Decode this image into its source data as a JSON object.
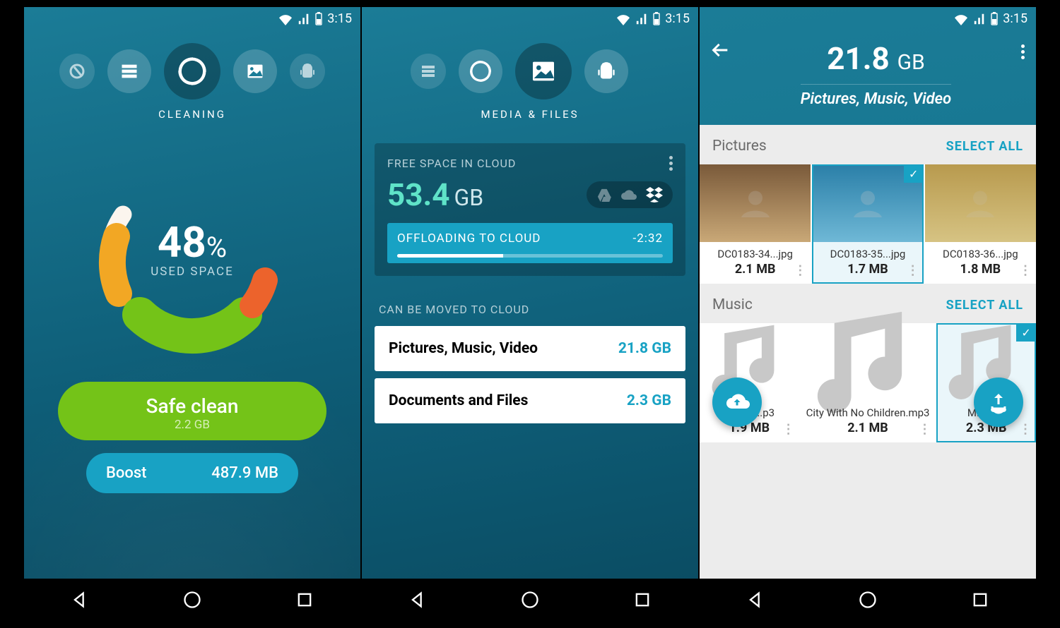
{
  "statusbar": {
    "time": "3:15"
  },
  "screen1": {
    "category_label": "CLEANING",
    "used_pct": "48",
    "pct_sym": "%",
    "used_label": "USED SPACE",
    "safe_clean": {
      "label": "Safe clean",
      "size": "2.2 GB"
    },
    "boost": {
      "label": "Boost",
      "size": "487.9 MB"
    }
  },
  "screen2": {
    "category_label": "MEDIA & FILES",
    "cloud_free_label": "FREE SPACE IN CLOUD",
    "cloud_free_value": "53.4",
    "cloud_free_unit": "GB",
    "offload_label": "OFFLOADING TO CLOUD",
    "offload_remaining": "-2:32",
    "move_label": "CAN BE MOVED TO CLOUD",
    "rows": [
      {
        "label": "Pictures, Music, Video",
        "value": "21.8 GB"
      },
      {
        "label": "Documents and Files",
        "value": "2.3 GB"
      }
    ]
  },
  "screen3": {
    "total_value": "21.8",
    "total_unit": "GB",
    "subtitle": "Pictures, Music, Video",
    "select_all": "SELECT ALL",
    "pictures_label": "Pictures",
    "music_label": "Music",
    "pictures": [
      {
        "name": "DC0183-34...jpg",
        "size": "2.1 MB",
        "selected": false
      },
      {
        "name": "DC0183-35...jpg",
        "size": "1.7 MB",
        "selected": true
      },
      {
        "name": "DC0183-36...jpg",
        "size": "1.8 MB",
        "selected": false
      }
    ],
    "music": [
      {
        "name": "...y To ...p3",
        "size": "1.9 MB",
        "selected": false
      },
      {
        "name": "City With No Children.mp3",
        "size": "2.1 MB",
        "selected": false
      },
      {
        "name": "M... M...",
        "size": "2.3 MB",
        "selected": true
      }
    ]
  }
}
